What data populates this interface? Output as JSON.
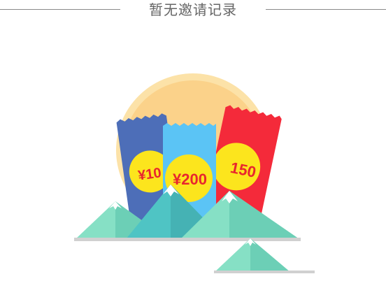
{
  "empty_state": {
    "title": "暂无邀请记录"
  },
  "illustration": {
    "envelope_left_amount": "¥10",
    "envelope_middle_amount": "¥200",
    "envelope_right_amount": "150"
  },
  "colors": {
    "sun_outer": "#FCE2A8",
    "sun_inner": "#FBD28A",
    "envelope_blue": "#4D6EB8",
    "envelope_light_blue": "#5BC4F5",
    "envelope_red": "#F42A3A",
    "coin_yellow": "#FCE51D",
    "amount_red": "#E8262E",
    "mountain_light": "#86E0C5",
    "mountain_mid": "#6CCFB6",
    "mountain_teal": "#4FC4C4",
    "ground_gray": "#D0D0D0"
  },
  "icons": [
    "red-envelope-icon",
    "mountain-icon",
    "sun-icon"
  ]
}
